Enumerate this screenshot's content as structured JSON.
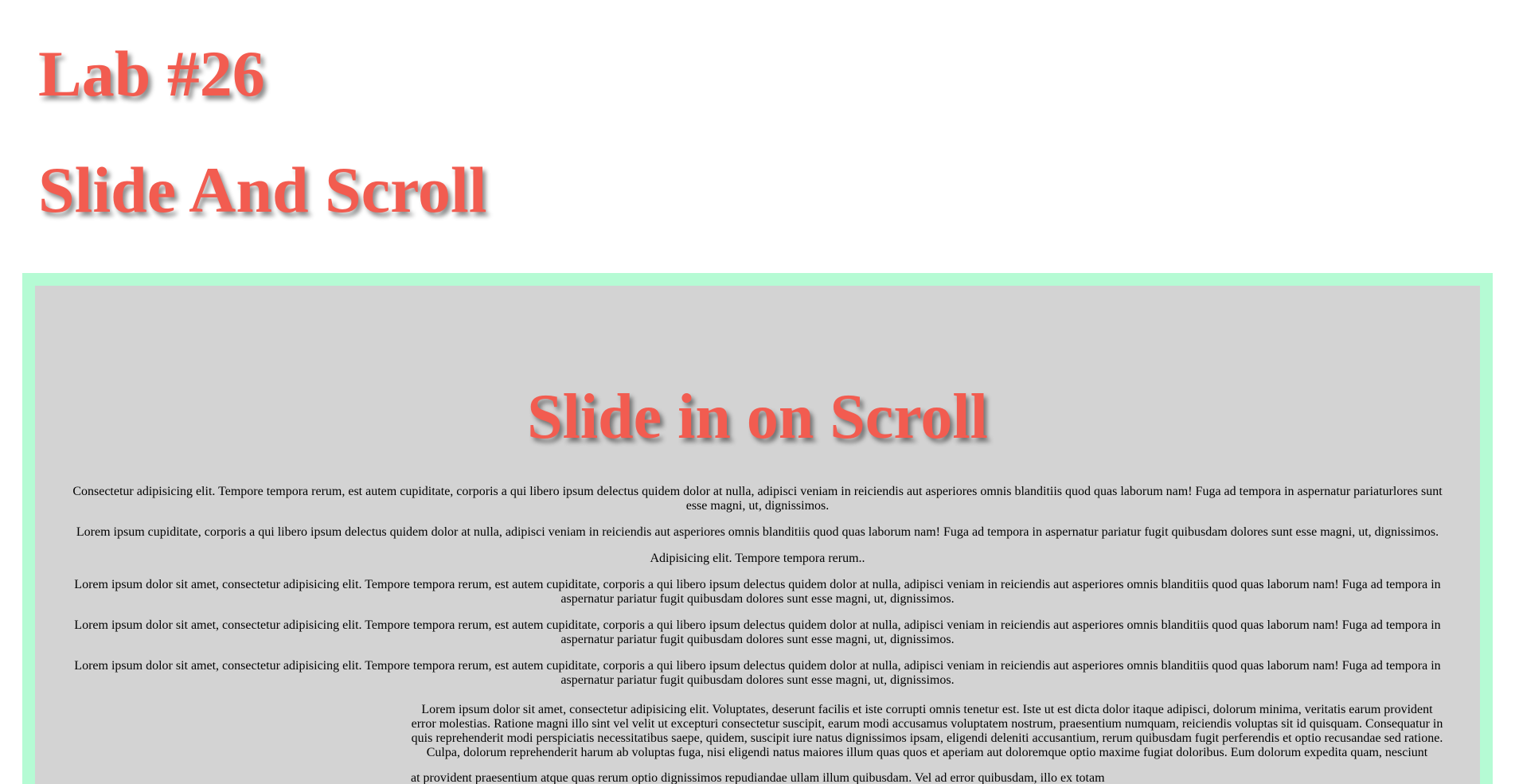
{
  "header": {
    "lab_title": "Lab #26",
    "lab_subtitle": "Slide And Scroll"
  },
  "section": {
    "title": "Slide in on Scroll",
    "paragraphs": [
      "Consectetur adipisicing elit. Tempore tempora rerum, est autem cupiditate, corporis a qui libero ipsum delectus quidem dolor at nulla, adipisci veniam in reiciendis aut asperiores omnis blanditiis quod quas laborum nam! Fuga ad tempora in aspernatur pariaturlores sunt esse magni, ut, dignissimos.",
      "Lorem ipsum cupiditate, corporis a qui libero ipsum delectus quidem dolor at nulla, adipisci veniam in reiciendis aut asperiores omnis blanditiis quod quas laborum nam! Fuga ad tempora in aspernatur pariatur fugit quibusdam dolores sunt esse magni, ut, dignissimos.",
      "Adipisicing elit. Tempore tempora rerum..",
      "Lorem ipsum dolor sit amet, consectetur adipisicing elit. Tempore tempora rerum, est autem cupiditate, corporis a qui libero ipsum delectus quidem dolor at nulla, adipisci veniam in reiciendis aut asperiores omnis blanditiis quod quas laborum nam! Fuga ad tempora in aspernatur pariatur fugit quibusdam dolores sunt esse magni, ut, dignissimos.",
      "Lorem ipsum dolor sit amet, consectetur adipisicing elit. Tempore tempora rerum, est autem cupiditate, corporis a qui libero ipsum delectus quidem dolor at nulla, adipisci veniam in reiciendis aut asperiores omnis blanditiis quod quas laborum nam! Fuga ad tempora in aspernatur pariatur fugit quibusdam dolores sunt esse magni, ut, dignissimos.",
      "Lorem ipsum dolor sit amet, consectetur adipisicing elit. Tempore tempora rerum, est autem cupiditate, corporis a qui libero ipsum delectus quidem dolor at nulla, adipisci veniam in reiciendis aut asperiores omnis blanditiis quod quas laborum nam! Fuga ad tempora in aspernatur pariatur fugit quibusdam dolores sunt esse magni, ut, dignissimos."
    ],
    "image_paragraph": "Lorem ipsum dolor sit amet, consectetur adipisicing elit. Voluptates, deserunt facilis et iste corrupti omnis tenetur est. Iste ut est dicta dolor itaque adipisci, dolorum minima, veritatis earum provident error molestias. Ratione magni illo sint vel velit ut excepturi consectetur suscipit, earum modi accusamus voluptatem nostrum, praesentium numquam, reiciendis voluptas sit id quisquam. Consequatur in quis reprehenderit modi perspiciatis necessitatibus saepe, quidem, suscipit iure natus dignissimos ipsam, eligendi deleniti accusantium, rerum quibusdam fugit perferendis et optio recusandae sed ratione. Culpa, dolorum reprehenderit harum ab voluptas fuga, nisi eligendi natus maiores illum quas quos et aperiam aut doloremque optio maxime fugiat doloribus. Eum dolorum expedita quam, nesciunt",
    "image_paragraph_2": "at provident praesentium atque quas rerum optio dignissimos repudiandae ullam illum quibusdam. Vel ad error quibusdam, illo ex totam"
  },
  "colors": {
    "heading": "#f25c50",
    "frame": "#b5fbd4",
    "panel": "#d3d3d3"
  }
}
